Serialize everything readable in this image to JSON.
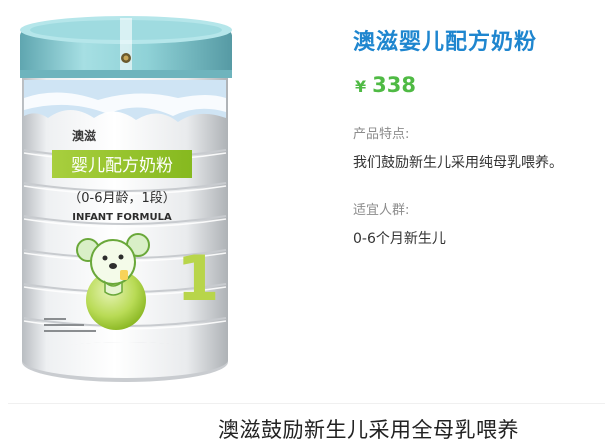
{
  "product": {
    "title": "澳滋婴儿配方奶粉",
    "currency_symbol": "¥",
    "price": "338",
    "features_label": "产品特点:",
    "features_value": "我们鼓励新生儿采用纯母乳喂养。",
    "audience_label": "适宜人群:",
    "audience_value": "0-6个月新生儿"
  },
  "can_label": {
    "brand": "澳滋",
    "name": "婴儿配方奶粉",
    "stage_text": "（0-6月龄，1段）",
    "english_name": "INFANT FORMULA",
    "stage_number": "1"
  },
  "caption": {
    "text": "澳滋鼓励新生儿采用全母乳喂养"
  },
  "colors": {
    "title_blue": "#1f86cf",
    "price_green": "#4fba44",
    "label_green": "#8fc31f",
    "lid_teal": "#7ec8cf"
  }
}
